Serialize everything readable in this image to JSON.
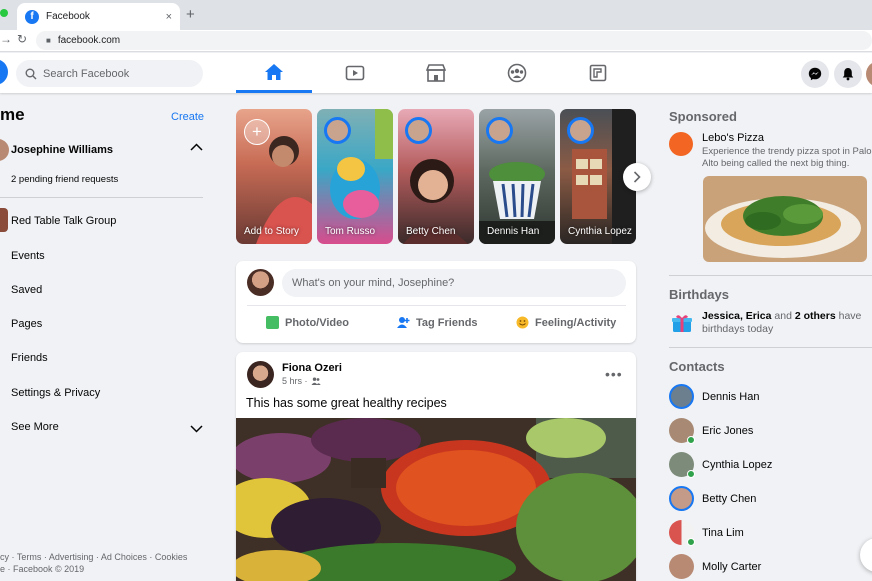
{
  "browser": {
    "tab_title": "Facebook",
    "tab_close": "×",
    "new_tab": "+",
    "url": "facebook.com"
  },
  "header": {
    "search_placeholder": "Search Facebook"
  },
  "left_sidebar": {
    "title": "me",
    "create_label": "Create",
    "profile_name": "Josephine Williams",
    "pending_requests": "2 pending friend requests",
    "items": [
      {
        "label": "Red Table Talk Group"
      },
      {
        "label": "Events"
      },
      {
        "label": "Saved"
      },
      {
        "label": "Pages"
      },
      {
        "label": "Friends"
      },
      {
        "label": "Settings & Privacy"
      },
      {
        "label": "See More"
      }
    ],
    "footer_line1": "cy · Terms · Advertising · Ad Choices · Cookies",
    "footer_line2": "e · Facebook © 2019"
  },
  "stories": [
    {
      "name": "Add to Story"
    },
    {
      "name": "Tom Russo"
    },
    {
      "name": "Betty Chen"
    },
    {
      "name": "Dennis Han"
    },
    {
      "name": "Cynthia Lopez"
    }
  ],
  "composer": {
    "placeholder": "What's on your mind, Josephine?",
    "photo_video": "Photo/Video",
    "tag_friends": "Tag Friends",
    "feeling": "Feeling/Activity"
  },
  "post": {
    "author": "Fiona Ozeri",
    "time": "5 hrs ·",
    "more": "•••",
    "text": "This has some great healthy recipes"
  },
  "right_sidebar": {
    "sponsored_heading": "Sponsored",
    "ad_title": "Lebo's Pizza",
    "ad_description": "Experience the trendy pizza spot in Palo Alto being called the next big thing.",
    "birthdays_heading": "Birthdays",
    "birthday_names": "Jessica, Erica",
    "birthday_and": " and ",
    "birthday_others": "2 others",
    "birthday_have": " have birthdays today",
    "contacts_heading": "Contacts",
    "contacts": [
      {
        "name": "Dennis Han"
      },
      {
        "name": "Eric Jones"
      },
      {
        "name": "Cynthia Lopez"
      },
      {
        "name": "Betty Chen"
      },
      {
        "name": "Tina Lim"
      },
      {
        "name": "Molly Carter"
      }
    ]
  },
  "colors": {
    "brand": "#1877f2",
    "online": "#31a24c",
    "background": "#f0f2f5"
  }
}
